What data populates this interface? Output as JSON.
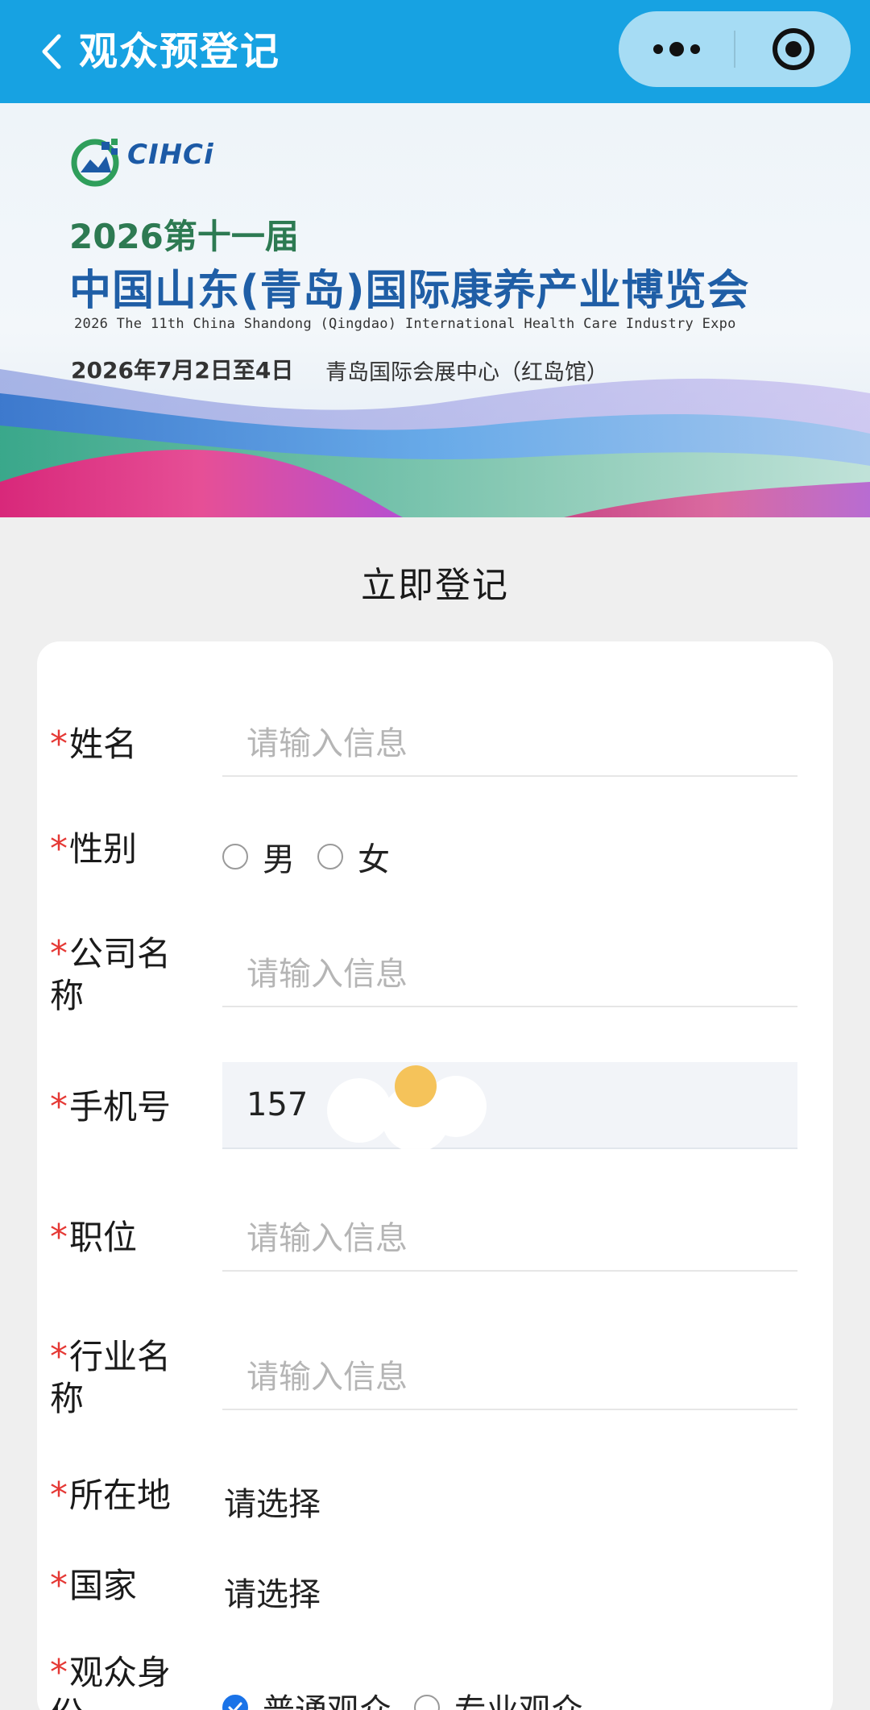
{
  "navbar": {
    "title": "观众预登记",
    "back_icon": "chevron-left-icon",
    "more_icon": "more-dots-icon",
    "close_icon": "target-circle-icon",
    "background": "#17a2e2"
  },
  "banner": {
    "logo_text": "CIHCi",
    "year_edition": "2026第十一届",
    "title": "中国山东(青岛)国际康养产业博览会",
    "subtitle": "2026 The 11th China Shandong (Qingdao) International Health Care Industry Expo",
    "date": "2026年7月2日至4日",
    "venue": "青岛国际会展中心（红岛馆）"
  },
  "form": {
    "section_title": "立即登记",
    "required_mark": "*",
    "placeholder": "请输入信息",
    "fields": {
      "name": {
        "label": "姓名"
      },
      "gender": {
        "label": "性别",
        "options": [
          "男",
          "女"
        ]
      },
      "company": {
        "label": "公司名称"
      },
      "phone": {
        "label": "手机号",
        "value": "157"
      },
      "position": {
        "label": "职位"
      },
      "industry": {
        "label": "行业名称"
      },
      "location": {
        "label": "所在地",
        "value": "请选择"
      },
      "country": {
        "label": "国家",
        "value": "请选择"
      },
      "identity": {
        "label": "观众身份",
        "options": [
          "普通观众",
          "专业观众"
        ],
        "selected": "普通观众"
      }
    }
  },
  "colors": {
    "accent": "#17a2e2",
    "required": "#e53935",
    "radio_checked": "#1a73e8"
  }
}
